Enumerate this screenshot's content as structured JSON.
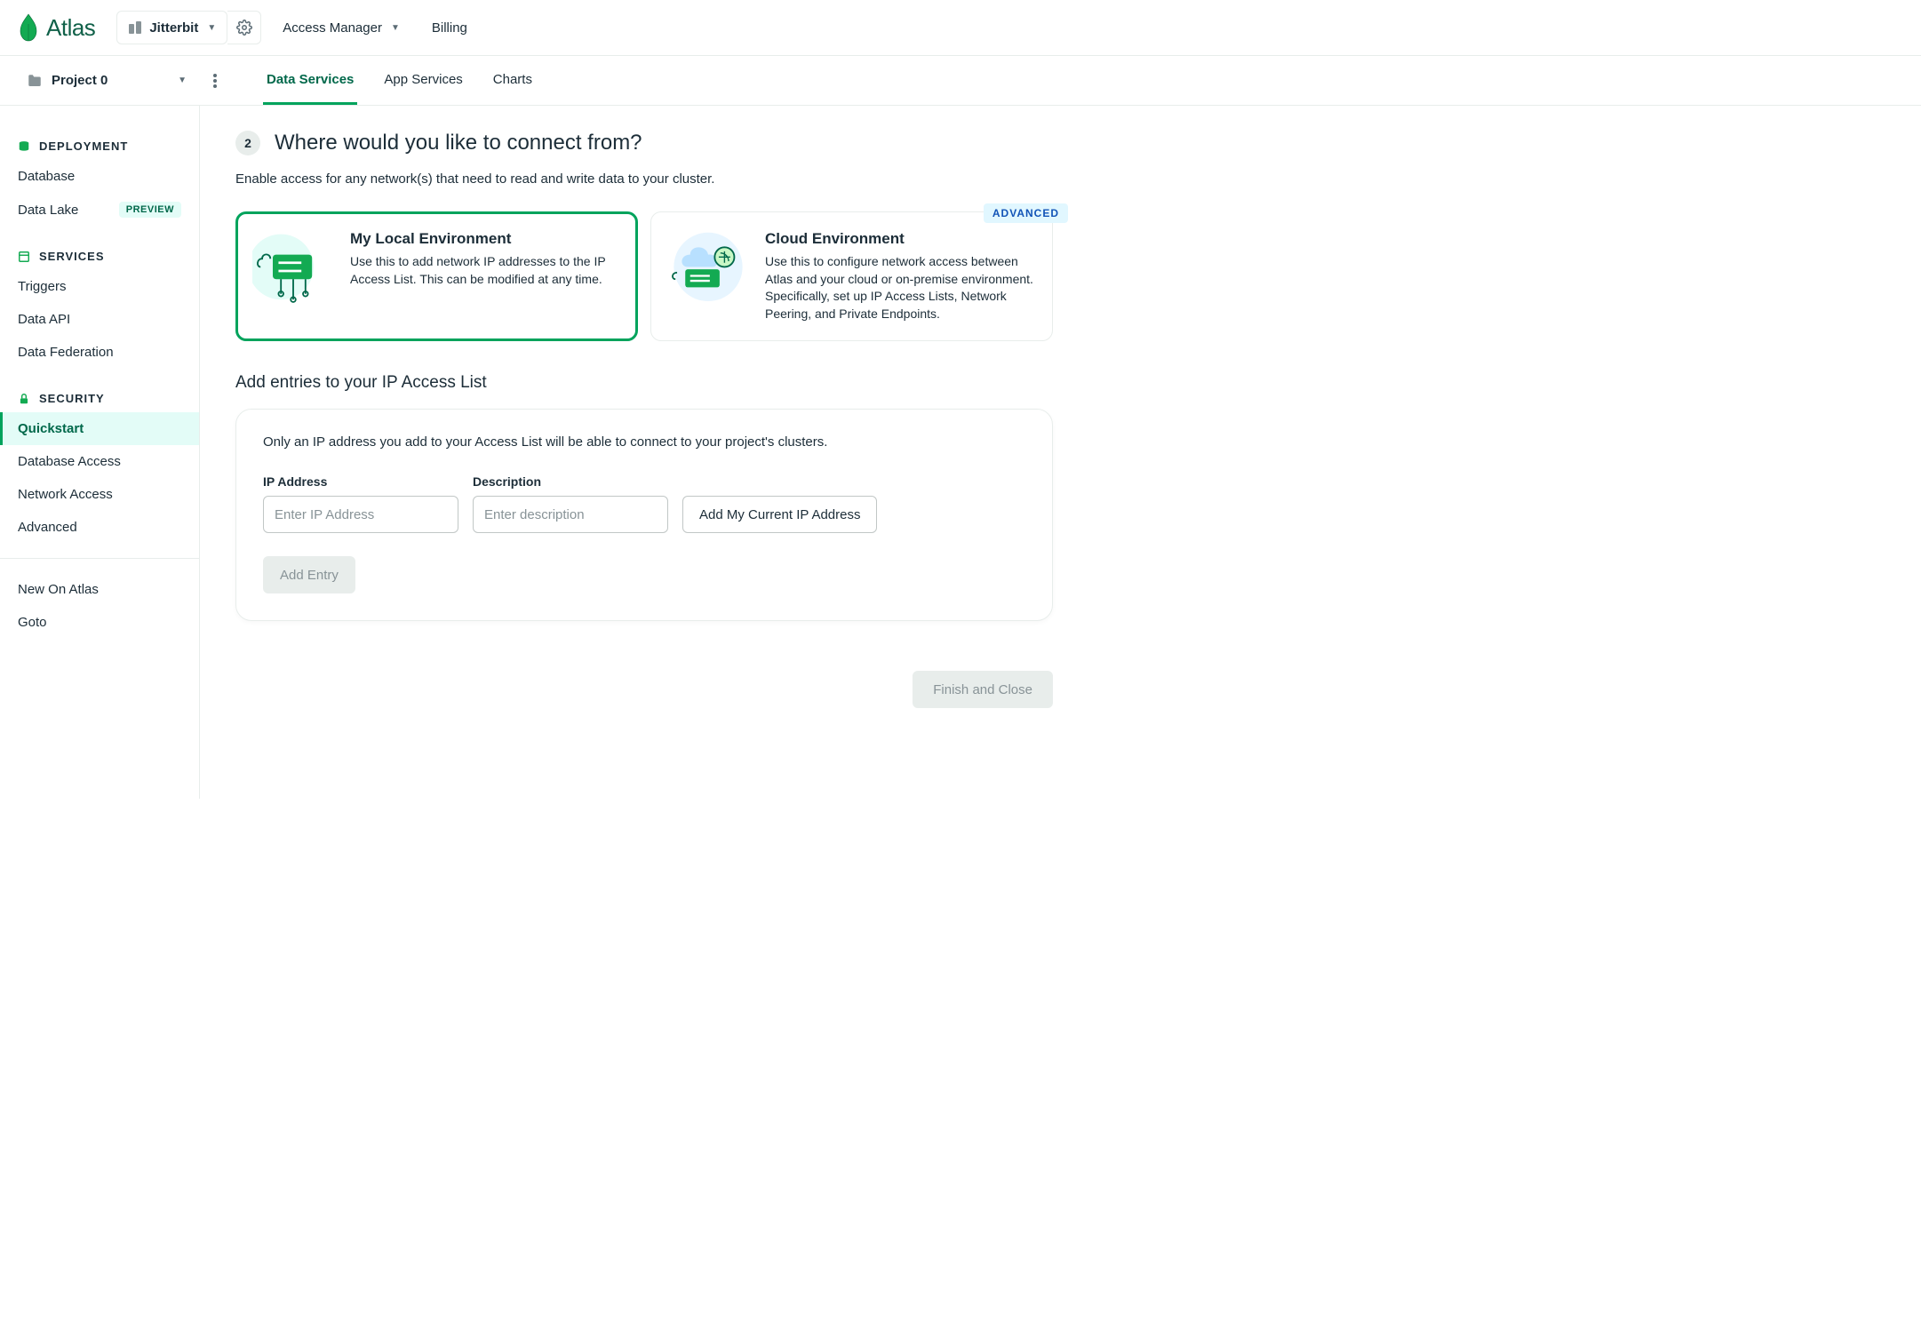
{
  "top": {
    "brand": "Atlas",
    "org_name": "Jitterbit",
    "access_manager": "Access Manager",
    "billing": "Billing"
  },
  "project": {
    "name": "Project 0"
  },
  "tabs": {
    "data_services": "Data Services",
    "app_services": "App Services",
    "charts": "Charts"
  },
  "sidebar": {
    "sections": {
      "deployment": "DEPLOYMENT",
      "services": "SERVICES",
      "security": "SECURITY"
    },
    "items": {
      "database": "Database",
      "data_lake": "Data Lake",
      "preview_badge": "PREVIEW",
      "triggers": "Triggers",
      "data_api": "Data API",
      "data_federation": "Data Federation",
      "quickstart": "Quickstart",
      "database_access": "Database Access",
      "network_access": "Network Access",
      "advanced": "Advanced",
      "new_on_atlas": "New On Atlas",
      "goto": "Goto"
    }
  },
  "main": {
    "step_number": "2",
    "step_title": "Where would you like to connect from?",
    "step_sub": "Enable access for any network(s) that need to read and write data to your cluster.",
    "options": {
      "local": {
        "title": "My Local Environment",
        "desc": "Use this to add network IP addresses to the IP Access List. This can be modified at any time."
      },
      "cloud": {
        "title": "Cloud Environment",
        "desc": "Use this to configure network access between Atlas and your cloud or on-premise environment. Specifically, set up IP Access Lists, Network Peering, and Private Endpoints.",
        "badge": "ADVANCED"
      }
    },
    "sub_heading": "Add entries to your IP Access List",
    "panel_note": "Only an IP address you add to your Access List will be able to connect to your project's clusters.",
    "fields": {
      "ip_label": "IP Address",
      "ip_placeholder": "Enter IP Address",
      "desc_label": "Description",
      "desc_placeholder": "Enter description"
    },
    "buttons": {
      "add_current_ip": "Add My Current IP Address",
      "add_entry": "Add Entry",
      "finish": "Finish and Close"
    }
  }
}
